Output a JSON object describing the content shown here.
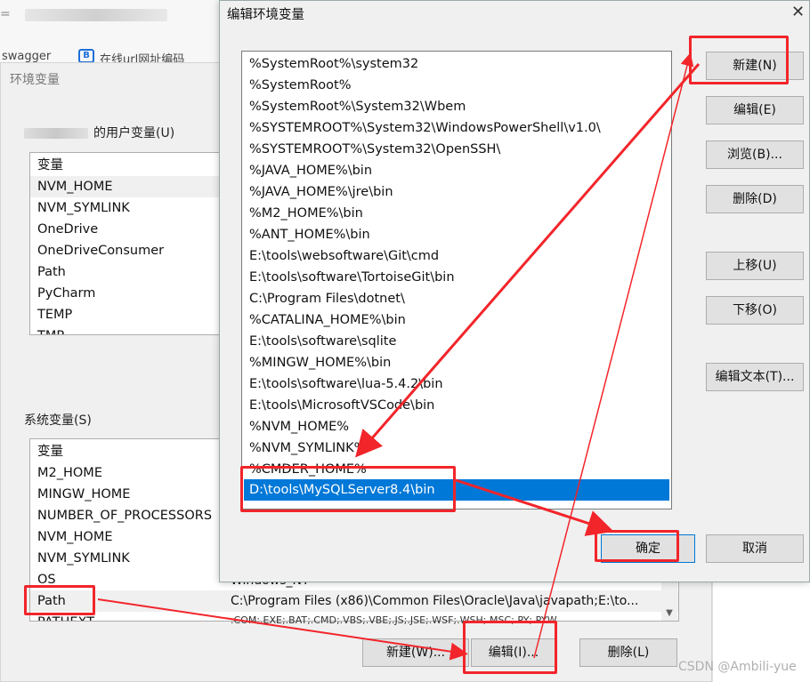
{
  "browser": {
    "url_prefix": "=",
    "bookmarks": [
      "swagger",
      "在线url网址编码"
    ],
    "bookmark_icon": "B"
  },
  "env_dialog": {
    "title": "环境变量",
    "user_vars_label": "的用户变量(U)",
    "user_vars": [
      "变量",
      "NVM_HOME",
      "NVM_SYMLINK",
      "OneDrive",
      "OneDriveConsumer",
      "Path",
      "PyCharm",
      "TEMP",
      "TMP"
    ],
    "sys_vars_label": "系统变量(S)",
    "sys_vars": [
      "变量",
      "M2_HOME",
      "MINGW_HOME",
      "NUMBER_OF_PROCESSORS",
      "NVM_HOME",
      "NVM_SYMLINK",
      "OS",
      "Path",
      "PATHEXT"
    ],
    "os_value": "Windows_NT",
    "path_value": "C:\\Program Files (x86)\\Common Files\\Oracle\\Java\\javapath;E:\\to...",
    "pathext_value": ".COM;.EXE;.BAT;.CMD;.VBS;.VBE;.JS;.JSE;.WSF;.WSH;.MSC;.PY;.PYW",
    "buttons": {
      "new": "新建(W)...",
      "edit": "编辑(I)...",
      "delete": "删除(L)"
    }
  },
  "edit_dialog": {
    "title": "编辑环境变量",
    "close": "✕",
    "paths": [
      "%SystemRoot%\\system32",
      "%SystemRoot%",
      "%SystemRoot%\\System32\\Wbem",
      "%SYSTEMROOT%\\System32\\WindowsPowerShell\\v1.0\\",
      "%SYSTEMROOT%\\System32\\OpenSSH\\",
      "%JAVA_HOME%\\bin",
      "%JAVA_HOME%\\jre\\bin",
      "%M2_HOME%\\bin",
      "%ANT_HOME%\\bin",
      "E:\\tools\\websoftware\\Git\\cmd",
      "E:\\tools\\software\\TortoiseGit\\bin",
      "C:\\Program Files\\dotnet\\",
      "%CATALINA_HOME%\\bin",
      "E:\\tools\\software\\sqlite",
      "%MINGW_HOME%\\bin",
      "E:\\tools\\software\\lua-5.4.2\\bin",
      "E:\\tools\\MicrosoftVSCode\\bin",
      "%NVM_HOME%",
      "%NVM_SYMLINK%",
      "%CMDER_HOME%",
      "D:\\tools\\MySQLServer8.4\\bin"
    ],
    "buttons": {
      "new": "新建(N)",
      "edit": "编辑(E)",
      "browse": "浏览(B)...",
      "delete": "删除(D)",
      "move_up": "上移(U)",
      "move_down": "下移(O)",
      "edit_text": "编辑文本(T)...",
      "ok": "确定",
      "cancel": "取消"
    }
  },
  "watermark": "CSDN @Ambili-yue",
  "colors": {
    "selection": "#0078d7",
    "annotation": "#f2252a"
  }
}
